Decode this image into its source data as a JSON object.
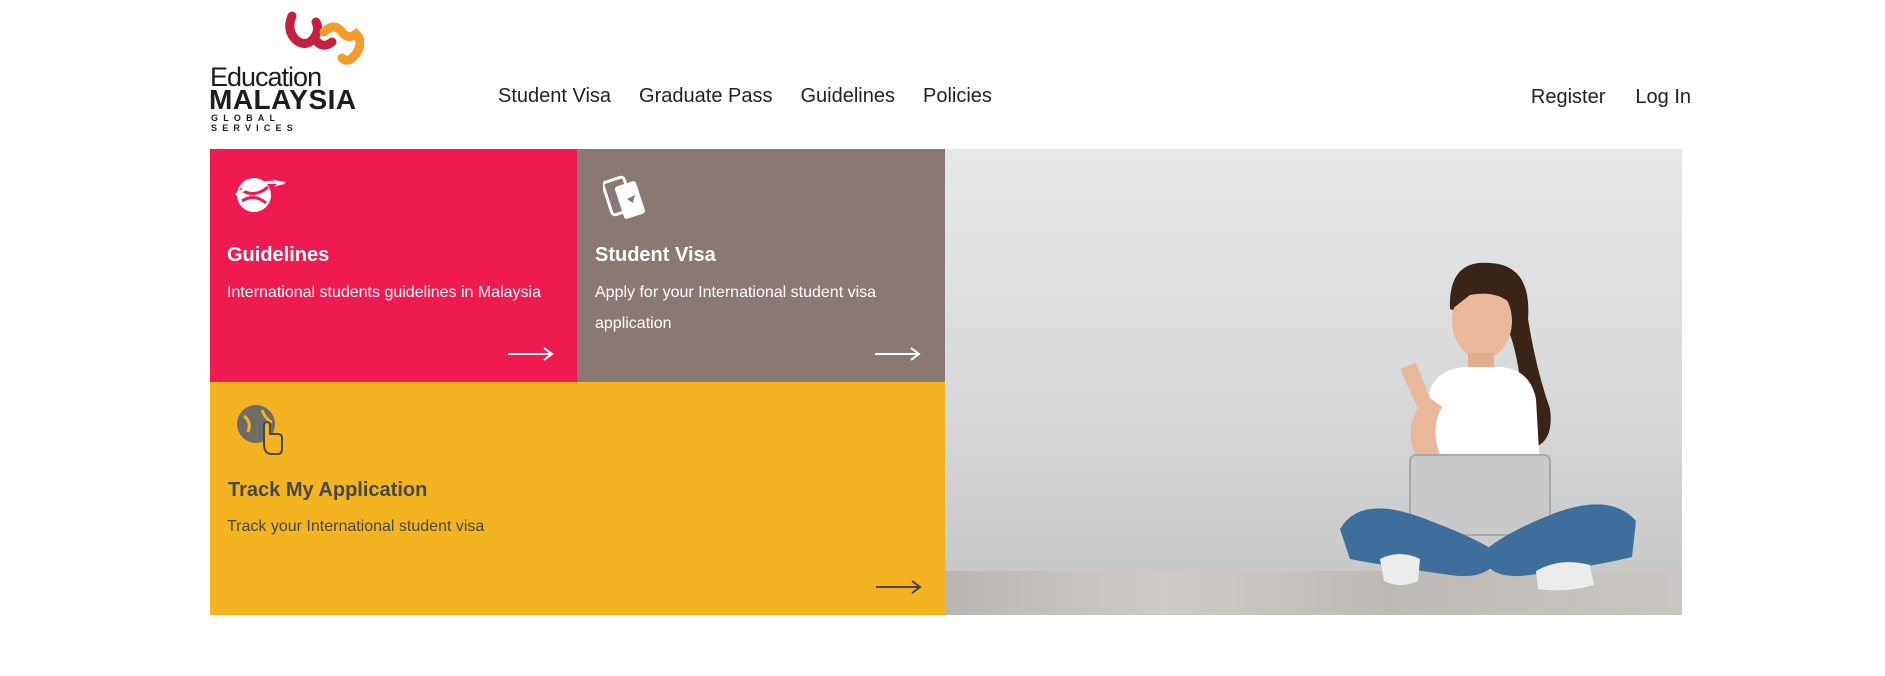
{
  "brand": {
    "line1": "Education",
    "line2": "MALAYSIA",
    "line3": "GLOBAL SERVICES",
    "colors": {
      "red": "#c4203f",
      "orange": "#f39c29"
    }
  },
  "nav": {
    "items": [
      {
        "label": "Student Visa"
      },
      {
        "label": "Graduate Pass"
      },
      {
        "label": "Guidelines"
      },
      {
        "label": "Policies"
      }
    ],
    "register_label": "Register",
    "login_label": "Log In"
  },
  "tiles": {
    "guidelines": {
      "title": "Guidelines",
      "description": "International students guidelines in Malaysia",
      "icon": "globe-plane-icon",
      "color": "#ef1a50"
    },
    "student_visa": {
      "title": "Student Visa",
      "description": "Apply for your International student visa application",
      "icon": "passport-ticket-icon",
      "color": "#8a7874"
    },
    "track": {
      "title": "Track My Application",
      "description": "Track your International student visa",
      "icon": "globe-hand-icon",
      "color": "#f4b320"
    }
  },
  "hero": {
    "image": "student-with-laptop-photo"
  }
}
